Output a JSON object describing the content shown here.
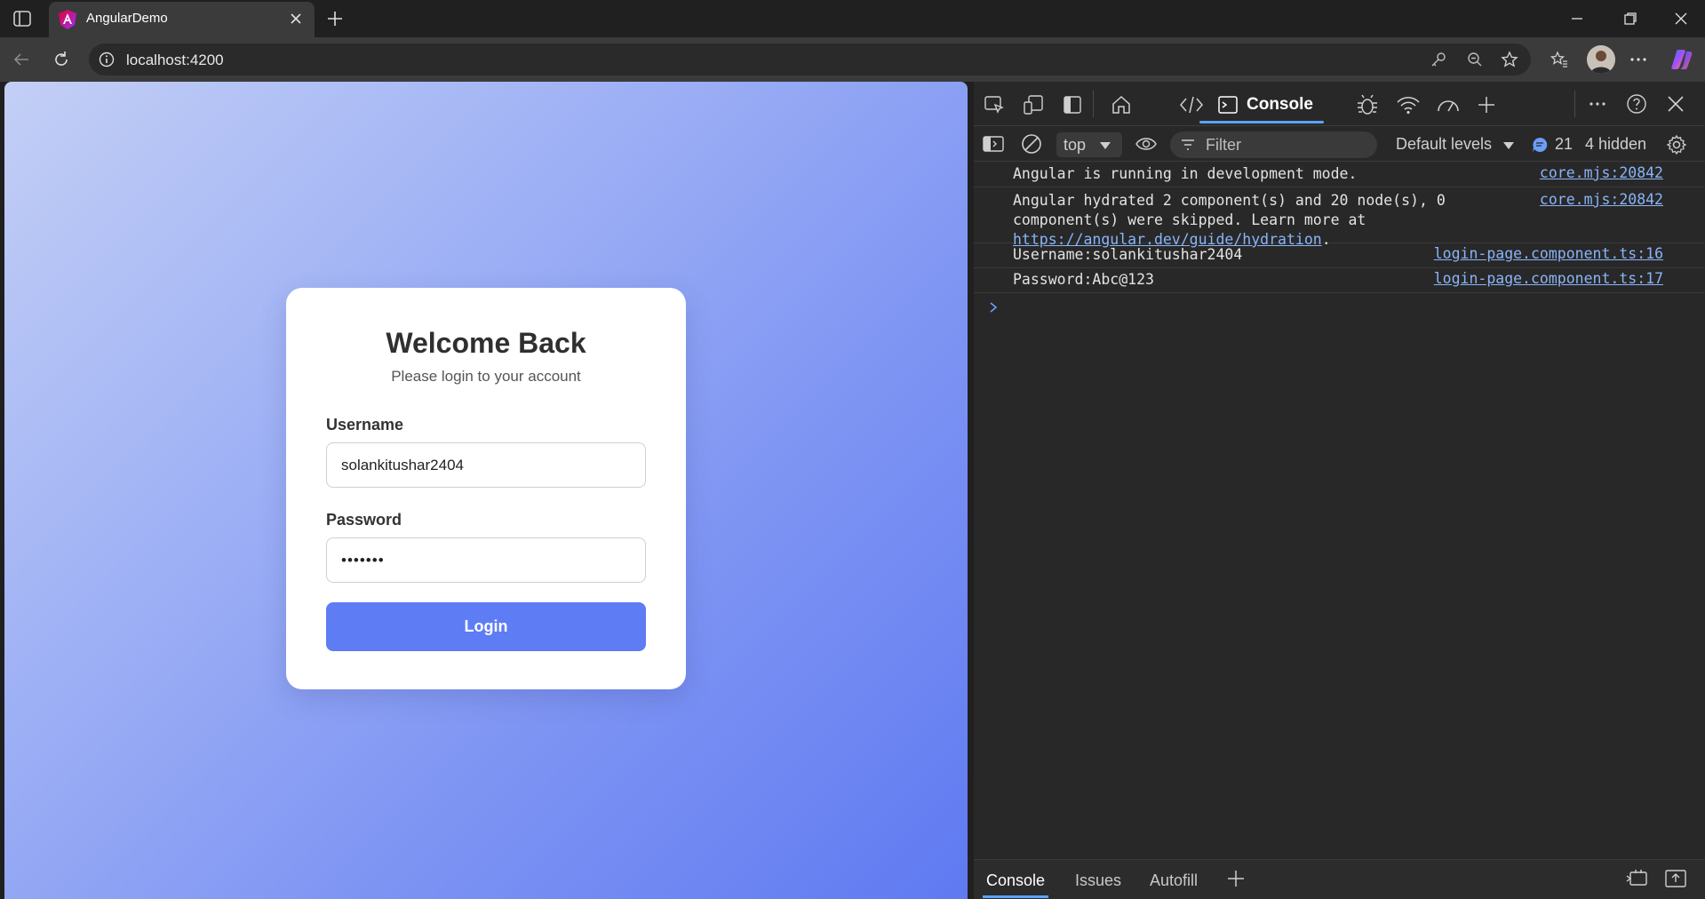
{
  "browser": {
    "tab_title": "AngularDemo",
    "url": "localhost:4200"
  },
  "login": {
    "heading": "Welcome Back",
    "subheading": "Please login to your account",
    "username_label": "Username",
    "username_value": "solankitushar2404",
    "password_label": "Password",
    "password_mask": "•••••••",
    "login_button": "Login"
  },
  "devtools": {
    "active_tab": "Console",
    "context": "top",
    "filter_placeholder": "Filter",
    "levels": "Default levels",
    "message_count": "21",
    "hidden": "4 hidden",
    "messages": [
      {
        "text": "Angular is running in development mode.",
        "source": "core.mjs:20842"
      },
      {
        "text_line1": "Angular hydrated 2 component(s) and 20 node(s), 0",
        "text_line2": "component(s) were skipped. Learn more at",
        "link": "https://angular.dev/guide/hydration",
        "link_suffix": ".",
        "source": "core.mjs:20842"
      },
      {
        "text": "Username:solankitushar2404",
        "source": "login-page.component.ts:16"
      },
      {
        "text": "Password:Abc@123",
        "source": "login-page.component.ts:17"
      }
    ],
    "bottom_tabs": [
      "Console",
      "Issues",
      "Autofill"
    ]
  },
  "colors": {
    "accent": "#5e7cf4",
    "devtools_bg": "#282828",
    "link": "#8ab4f8"
  }
}
